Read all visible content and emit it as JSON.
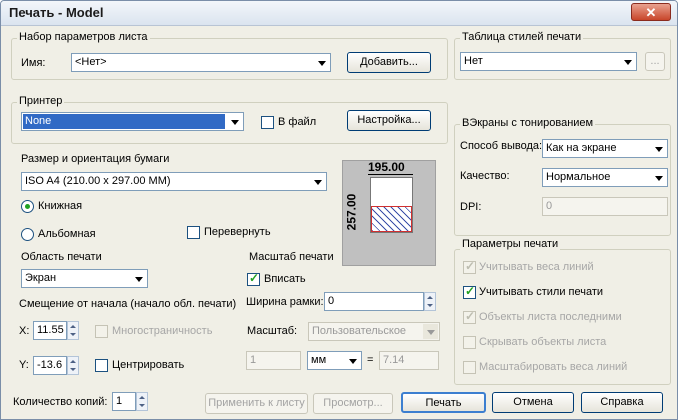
{
  "window": {
    "title": "Печать - Model",
    "close_icon": "✕"
  },
  "page_setup": {
    "legend": "Набор параметров листа",
    "name_label": "Имя:",
    "name_value": "<Нет>",
    "add_button": "Добавить..."
  },
  "printer": {
    "legend": "Принтер",
    "name_value": "None",
    "to_file_label": "В файл",
    "setup_button": "Настройка..."
  },
  "paper": {
    "legend": "Размер и ориентация бумаги",
    "size_value": "ISO A4 (210.00 x 297.00 MM)",
    "portrait_label": "Книжная",
    "landscape_label": "Альбомная",
    "flip_label": "Перевернуть",
    "preview_width": "195.00",
    "preview_height": "257.00"
  },
  "print_area": {
    "legend": "Область печати",
    "value": "Экран"
  },
  "offset": {
    "legend": "Смещение от начала (начало обл. печати)",
    "x_label": "X:",
    "x_value": "11.55",
    "y_label": "Y:",
    "y_value": "-13.6",
    "multipage_label": "Многостраничность",
    "center_label": "Центрировать"
  },
  "scale": {
    "legend": "Масштаб печати",
    "fit_label": "Вписать",
    "frame_width_label": "Ширина рамки:",
    "frame_width_value": "0",
    "scale_label": "Масштаб:",
    "scale_value": "Пользовательское",
    "num_value": "1",
    "units_value": "мм",
    "equals": "=",
    "result_value": "7.14"
  },
  "plot_style": {
    "legend": "Таблица стилей печати",
    "value": "Нет",
    "edit_button": "..."
  },
  "shaded": {
    "legend": "ВЭкраны с тонированием",
    "mode_label": "Способ вывода:",
    "mode_value": "Как на экране",
    "quality_label": "Качество:",
    "quality_value": "Нормальное",
    "dpi_label": "DPI:",
    "dpi_value": "0"
  },
  "options": {
    "legend": "Параметры печати",
    "items": [
      {
        "label": "Учитывать веса линий",
        "checked": true,
        "enabled": false
      },
      {
        "label": "Учитывать стили печати",
        "checked": true,
        "enabled": true
      },
      {
        "label": "Объекты листа последними",
        "checked": true,
        "enabled": false
      },
      {
        "label": "Скрывать объекты листа",
        "checked": false,
        "enabled": false
      },
      {
        "label": "Масштабировать веса линий",
        "checked": false,
        "enabled": false
      }
    ]
  },
  "bottom": {
    "copies_label": "Количество копий:",
    "copies_value": "1",
    "apply_button": "Применить к листу",
    "preview_button": "Просмотр...",
    "print_button": "Печать",
    "cancel_button": "Отмена",
    "help_button": "Справка"
  },
  "check_mark": "✓"
}
